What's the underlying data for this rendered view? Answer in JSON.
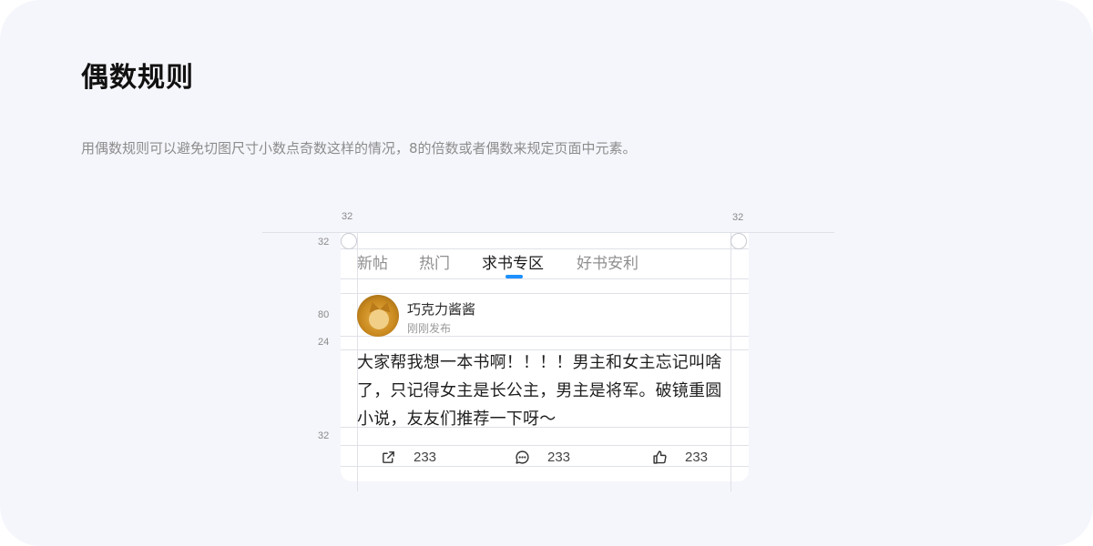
{
  "heading": "偶数规则",
  "description": "用偶数规则可以避免切图尺寸小数点奇数这样的情况，8的倍数或者偶数来规定页面中元素。",
  "dimensions": {
    "left_margin": "32",
    "right_margin": "32",
    "tab_bar_height": "32",
    "header_height": "80",
    "header_gap": "24",
    "footer_gap": "32"
  },
  "tabs": [
    {
      "label": "新帖",
      "active": false
    },
    {
      "label": "热门",
      "active": false
    },
    {
      "label": "求书专区",
      "active": true
    },
    {
      "label": "好书安利",
      "active": false
    }
  ],
  "post": {
    "author": "巧克力酱酱",
    "time": "刚刚发布",
    "lines": [
      "大家帮我想一本书啊！！！！男主和女主忘记叫啥",
      "了，只记得女主是长公主，男主是将军。破镜重圆",
      "小说，友友们推荐一下呀～"
    ]
  },
  "actions": [
    {
      "icon": "share-icon",
      "count": "233"
    },
    {
      "icon": "comment-icon",
      "count": "233"
    },
    {
      "icon": "like-icon",
      "count": "233"
    }
  ],
  "colors": {
    "page_background": "#f5f6fb",
    "tab_accent": "#1e90ff",
    "guide_line": "#dfe1e8"
  }
}
